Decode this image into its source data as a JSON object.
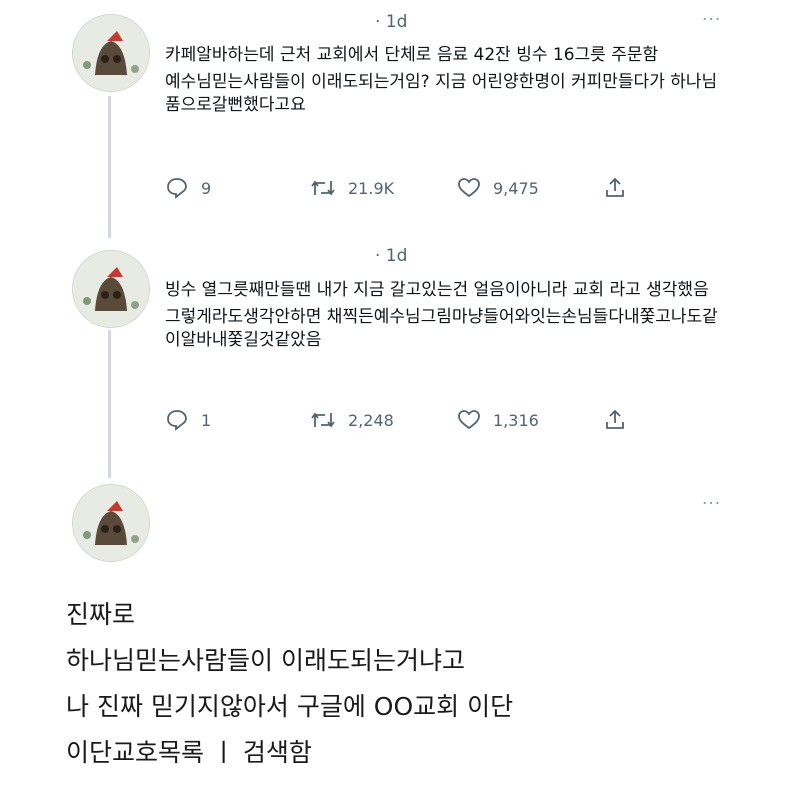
{
  "tweets": [
    {
      "time": "· 1d",
      "more": "···",
      "lines": [
        "카페알바하는데 근처 교회에서 단체로 음료 42잔 빙수 16그릇 주문함",
        "예수님믿는사람들이 이래도되는거임? 지금 어린양한명이 커피만들다가 하나님품으로갈뻔했다고요"
      ],
      "actions": {
        "replies": "9",
        "retweets": "21.9K",
        "likes": "9,475"
      }
    },
    {
      "time": "· 1d",
      "more": "···",
      "lines": [
        "빙수 열그릇째만들땐 내가 지금 갈고있는건 얼음이아니라 교회 라고 생각했음",
        "그렇게라도생각안하면 채찍든예수님그림마냥들어와잇는손님들다내쫓고나도같이알바내쫓길것같았음"
      ],
      "actions": {
        "replies": "1",
        "retweets": "2,248",
        "likes": "1,316"
      }
    },
    {
      "more": "···"
    }
  ],
  "bottom_text": {
    "lines": [
      "진짜로",
      "하나님믿는사람들이 이래도되는거냐고",
      "나 진짜 믿기지않아서 구글에 OO교회 이단",
      "이단교호목록 ㅣ 검색함"
    ]
  },
  "icons": {
    "reply": "reply-icon",
    "retweet": "retweet-icon",
    "like": "like-icon",
    "share": "share-icon",
    "avatar": "avatar-image"
  }
}
